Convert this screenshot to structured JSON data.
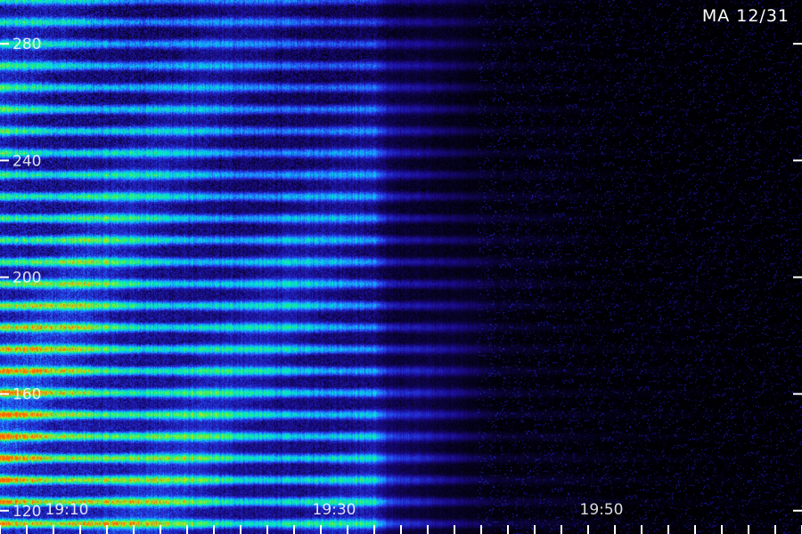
{
  "chart_data": {
    "type": "heatmap",
    "title": "MA 12/31",
    "xlabel": "",
    "ylabel": "",
    "y_tick_labels": [
      "120",
      "160",
      "200",
      "240",
      "280"
    ],
    "y_tick_values": [
      120,
      160,
      200,
      240,
      280
    ],
    "x_tick_labels": [
      "19:10",
      "19:30",
      "19:50"
    ],
    "x_tick_minutes": [
      10,
      30,
      50
    ],
    "x_range_minutes": [
      5,
      65
    ],
    "y_range": [
      112,
      295
    ],
    "colormap": [
      "#000000",
      "#1a0a8a",
      "#2436e0",
      "#1e8cff",
      "#00e0e0",
      "#28f070",
      "#b4f020",
      "#ff6600"
    ],
    "activity_profile": [
      {
        "minute": 5,
        "intensity": 0.95
      },
      {
        "minute": 10,
        "intensity": 0.9
      },
      {
        "minute": 15,
        "intensity": 0.78
      },
      {
        "minute": 20,
        "intensity": 0.68
      },
      {
        "minute": 25,
        "intensity": 0.62
      },
      {
        "minute": 30,
        "intensity": 0.6
      },
      {
        "minute": 33,
        "intensity": 0.55
      },
      {
        "minute": 34,
        "intensity": 0.28
      },
      {
        "minute": 38,
        "intensity": 0.18
      },
      {
        "minute": 42,
        "intensity": 0.06
      },
      {
        "minute": 50,
        "intensity": 0.02
      },
      {
        "minute": 65,
        "intensity": 0.01
      }
    ]
  }
}
